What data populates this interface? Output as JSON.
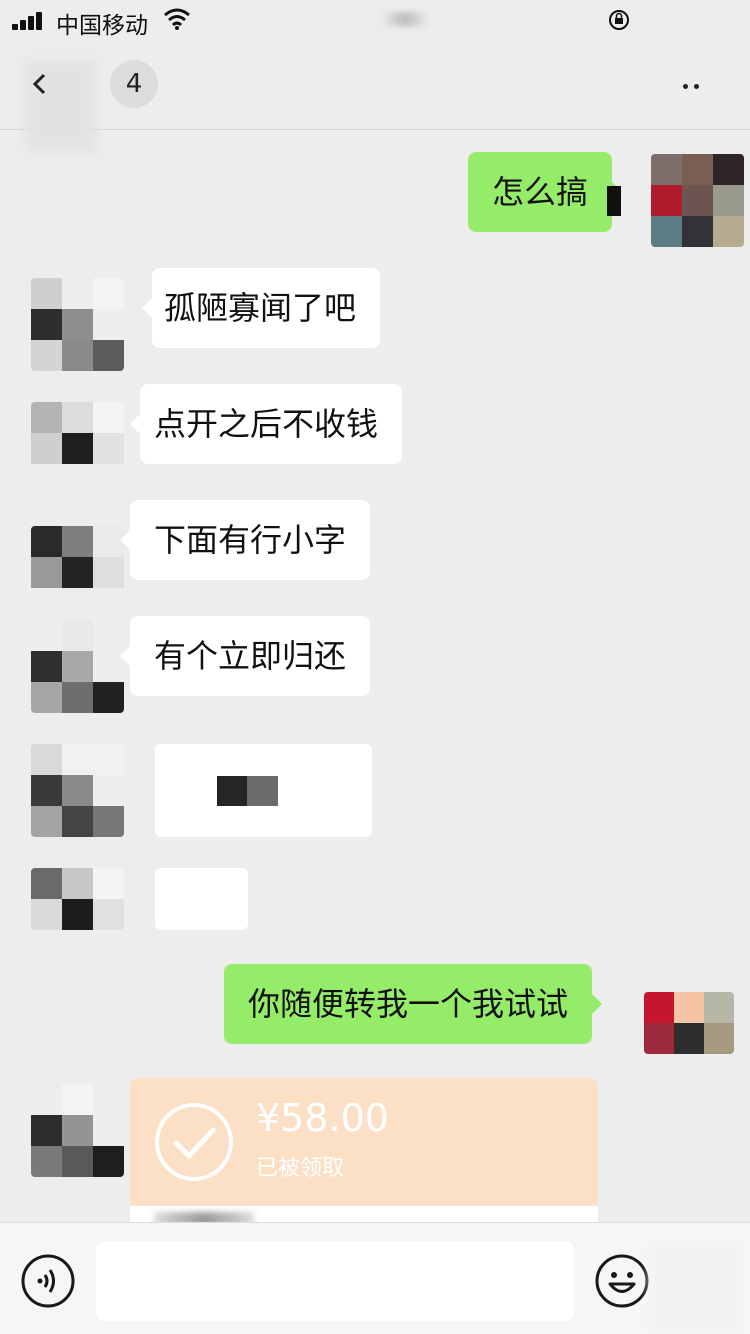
{
  "status_bar": {
    "carrier": "中国移动",
    "icons": [
      "signal-icon",
      "wifi-icon",
      "rotation-lock-icon"
    ]
  },
  "nav": {
    "back_badge": "4",
    "icons": [
      "chevron-left-icon",
      "more-icon"
    ]
  },
  "messages": [
    {
      "side": "right",
      "text": "怎么搞"
    },
    {
      "side": "left",
      "text": "孤陋寡闻了吧"
    },
    {
      "side": "left",
      "text": "点开之后不收钱"
    },
    {
      "side": "left",
      "text": "下面有行小字"
    },
    {
      "side": "left",
      "text": "有个立即归还"
    },
    {
      "side": "left",
      "type": "image",
      "text": ""
    },
    {
      "side": "left",
      "type": "image",
      "text": ""
    },
    {
      "side": "right",
      "text": "你随便转我一个我试试"
    }
  ],
  "transfer": {
    "amount": "¥58.00",
    "status": "已被领取",
    "icon": "check-circle-icon"
  },
  "input_bar": {
    "value": "",
    "icons": [
      "voice-icon",
      "emoji-icon"
    ]
  }
}
